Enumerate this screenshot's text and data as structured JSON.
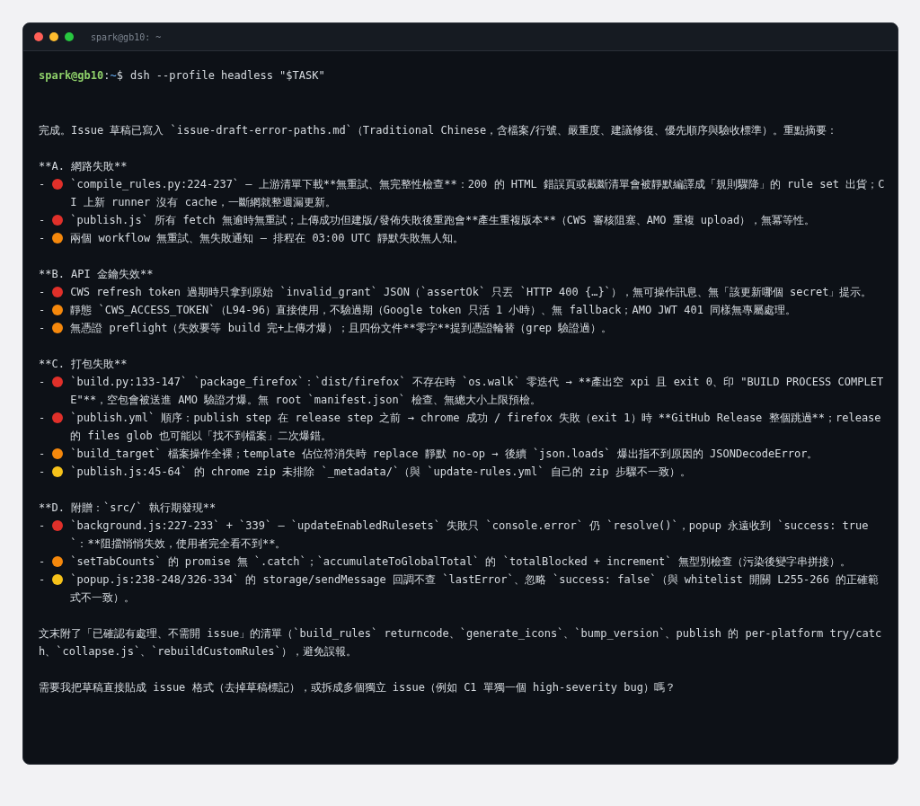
{
  "window": {
    "title": "spark@gb10: ~"
  },
  "prompt": {
    "user_host": "spark@gb10",
    "separator": ":",
    "path": "~",
    "symbol": "$",
    "command": "dsh --profile headless \"$TASK\""
  },
  "output": [
    {
      "kind": "paragraph",
      "text": "完成。Issue 草稿已寫入 `issue-draft-error-paths.md`（Traditional Chinese，含檔案/行號、嚴重度、建議修復、優先順序與驗收標準）。重點摘要："
    },
    {
      "kind": "section",
      "heading": "**A. 網路失敗**",
      "items": [
        {
          "marker": "-",
          "color": "#e0302a",
          "text": "`compile_rules.py:224-237` — 上游清單下載**無重試、無完整性檢查**：200 的 HTML 錯誤頁或截斷清單會被靜默編譯成「規則驟降」的 rule set 出貨；CI 上新 runner 沒有 cache，一斷網就整週漏更新。"
        },
        {
          "marker": "-",
          "color": "#e0302a",
          "text": "`publish.js` 所有 fetch 無逾時無重試；上傳成功但建版/發佈失敗後重跑會**產生重複版本**（CWS 審核阻塞、AMO 重複 upload），無冪等性。"
        },
        {
          "marker": "-",
          "color": "#f5880c",
          "text": "兩個 workflow 無重試、無失敗通知 — 排程在 03:00 UTC 靜默失敗無人知。"
        }
      ]
    },
    {
      "kind": "section",
      "heading": "**B. API 金鑰失效**",
      "items": [
        {
          "marker": "-",
          "color": "#e0302a",
          "text": "CWS refresh token 過期時只拿到原始 `invalid_grant` JSON（`assertOk` 只丟 `HTTP 400 {…}`），無可操作訊息、無「該更新哪個 secret」提示。"
        },
        {
          "marker": "-",
          "color": "#f5880c",
          "text": "靜態 `CWS_ACCESS_TOKEN`（L94-96）直接使用，不驗過期（Google token 只活 1 小時）、無 fallback；AMO JWT 401 同樣無專屬處理。"
        },
        {
          "marker": "-",
          "color": "#f5880c",
          "text": "無憑證 preflight（失效要等 build 完+上傳才爆）；且四份文件**零字**提到憑證輪替（grep 驗證過）。"
        }
      ]
    },
    {
      "kind": "section",
      "heading": "**C. 打包失敗**",
      "items": [
        {
          "marker": "-",
          "color": "#e0302a",
          "text": "`build.py:133-147` `package_firefox`：`dist/firefox` 不存在時 `os.walk` 零迭代 → **產出空 xpi 且 exit 0、印 \"BUILD PROCESS COMPLETE\"**，空包會被送進 AMO 驗證才爆。無 root `manifest.json` 檢查、無總大小上限預檢。"
        },
        {
          "marker": "-",
          "color": "#e0302a",
          "text": "`publish.yml` 順序：publish step 在 release step 之前 → chrome 成功 / firefox 失敗（exit 1）時 **GitHub Release 整個跳過**；release 的 files glob 也可能以「找不到檔案」二次爆錯。"
        },
        {
          "marker": "-",
          "color": "#f5880c",
          "text": "`build_target` 檔案操作全裸；template 佔位符消失時 replace 靜默 no-op → 後續 `json.loads` 爆出指不到原因的 JSONDecodeError。"
        },
        {
          "marker": "-",
          "color": "#f6c21a",
          "text": "`publish.js:45-64` 的 chrome zip 未排除 `_metadata/`（與 `update-rules.yml` 自己的 zip 步驟不一致）。"
        }
      ]
    },
    {
      "kind": "section",
      "heading": "**D. 附贈：`src/` 執行期發現**",
      "items": [
        {
          "marker": "-",
          "color": "#e0302a",
          "text": "`background.js:227-233` + `339` — `updateEnabledRulesets` 失敗只 `console.error` 仍 `resolve()`，popup 永遠收到 `success: true`：**阻擋悄悄失效，使用者完全看不到**。"
        },
        {
          "marker": "-",
          "color": "#f5880c",
          "text": "`setTabCounts` 的 promise 無 `.catch`；`accumulateToGlobalTotal` 的 `totalBlocked + increment` 無型別檢查（污染後變字串拼接）。"
        },
        {
          "marker": "-",
          "color": "#f6c21a",
          "text": "`popup.js:238-248/326-334` 的 storage/sendMessage 回調不查 `lastError`、忽略 `success: false`（與 whitelist 開關 L255-266 的正確範式不一致）。"
        }
      ]
    },
    {
      "kind": "paragraph",
      "text": "文末附了「已確認有處理、不需開 issue」的清單（`build_rules` returncode、`generate_icons`、`bump_version`、publish 的 per-platform try/catch、`collapse.js`、`rebuildCustomRules`），避免誤報。"
    },
    {
      "kind": "paragraph",
      "text": "需要我把草稿直接貼成 issue 格式（去掉草稿標記），或拆成多個獨立 issue（例如 C1 單獨一個 high-severity bug）嗎？"
    }
  ]
}
